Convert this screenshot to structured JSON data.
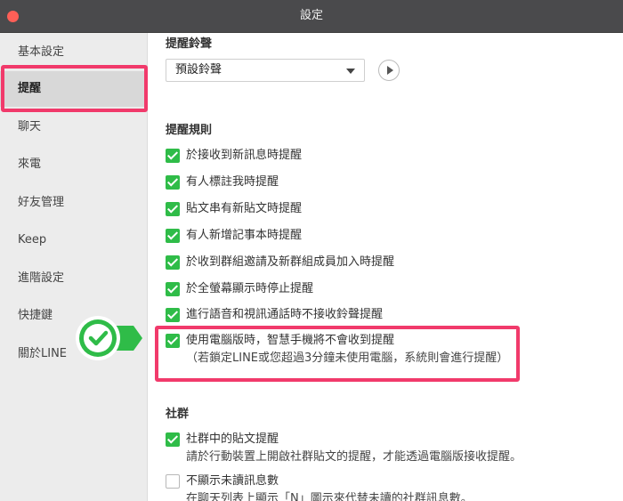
{
  "window": {
    "title": "設定"
  },
  "sidebar": {
    "items": [
      {
        "label": "基本設定"
      },
      {
        "label": "提醒"
      },
      {
        "label": "聊天"
      },
      {
        "label": "來電"
      },
      {
        "label": "好友管理"
      },
      {
        "label": "Keep"
      },
      {
        "label": "進階設定"
      },
      {
        "label": "快捷鍵"
      },
      {
        "label": "關於LINE"
      }
    ],
    "active_index": 1
  },
  "ringtone": {
    "heading": "提醒鈴聲",
    "selected": "預設鈴聲"
  },
  "rules": {
    "heading": "提醒規則",
    "options": [
      {
        "label": "於接收到新訊息時提醒",
        "checked": true
      },
      {
        "label": "有人標註我時提醒",
        "checked": true
      },
      {
        "label": "貼文串有新貼文時提醒",
        "checked": true
      },
      {
        "label": "有人新增記事本時提醒",
        "checked": true
      },
      {
        "label": "於收到群組邀請及新群組成員加入時提醒",
        "checked": true
      },
      {
        "label": "於全螢幕顯示時停止提醒",
        "checked": true
      },
      {
        "label": "進行語音和視訊通話時不接收鈴聲提醒",
        "checked": true
      },
      {
        "label": "使用電腦版時，智慧手機將不會收到提醒",
        "sublabel": "（若鎖定LINE或您超過3分鐘未使用電腦，系統則會進行提醒）",
        "checked": true
      }
    ]
  },
  "community": {
    "heading": "社群",
    "options": [
      {
        "label": "社群中的貼文提醒",
        "sublabel": "請於行動裝置上開啟社群貼文的提醒，才能透過電腦版接收提醒。",
        "checked": true
      },
      {
        "label": "不顯示未讀訊息數",
        "sublabel": "在聊天列表上顯示「N」圖示來代替未讀的社群訊息數。",
        "checked": false
      }
    ]
  },
  "colors": {
    "accent": "#2fbc48",
    "highlight": "#f13a6b",
    "titlebar": "#4a4a4c",
    "close": "#fe5f57"
  },
  "icons": {
    "close": "close-dot-icon",
    "play": "play-icon",
    "dropdown": "chevron-down-icon",
    "checkmark": "checkmark-badge-icon"
  }
}
